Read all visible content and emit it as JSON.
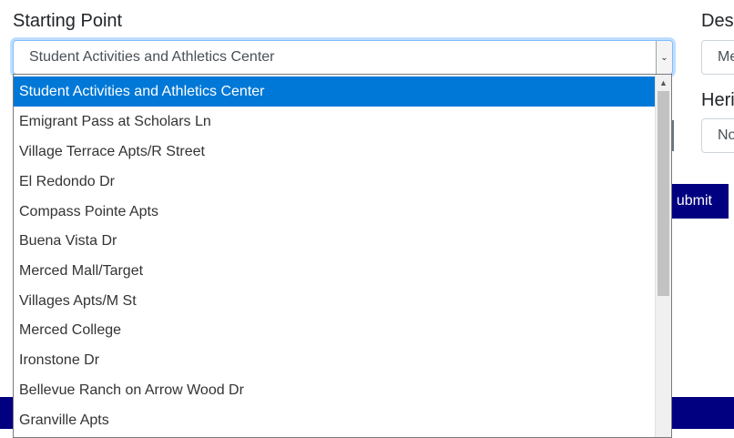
{
  "form": {
    "starting_point_label": "Starting Point",
    "starting_point_value": "Student Activities and Athletics Center",
    "destination_label": "Dest",
    "destination_value": "Me",
    "heritage_label": "Heri",
    "heritage_value": "No",
    "submit_label": "ubmit"
  },
  "dropdown": {
    "options": [
      "Student Activities and Athletics Center",
      "Emigrant Pass at Scholars Ln",
      "Village Terrace Apts/R Street",
      "El Redondo Dr",
      "Compass Pointe Apts",
      "Buena Vista Dr",
      "Merced Mall/Target",
      "Villages Apts/M St",
      "Merced College",
      "Ironstone Dr",
      "Bellevue Ranch on Arrow Wood Dr",
      "Granville Apts"
    ],
    "selected_index": 0
  },
  "icons": {
    "select_arrow": "chevron-down-icon",
    "scroll_up": "scroll-up-arrow-icon"
  },
  "colors": {
    "accent": "#000080",
    "selected_option": "#0078d7"
  }
}
